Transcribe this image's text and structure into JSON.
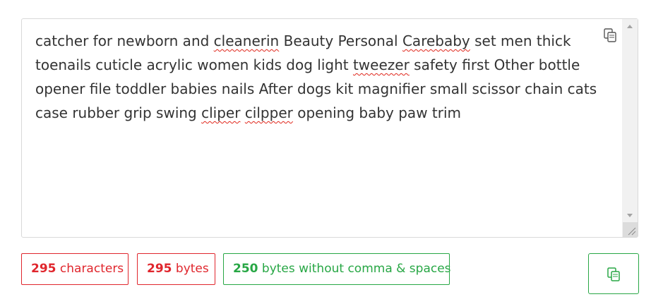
{
  "editor": {
    "segments": [
      {
        "text": "catcher for newborn and ",
        "misspelled": false
      },
      {
        "text": "cleanerin",
        "misspelled": true
      },
      {
        "text": " Beauty Personal ",
        "misspelled": false
      },
      {
        "text": "Carebaby",
        "misspelled": true
      },
      {
        "text": " set men thick toenails cuticle acrylic women kids dog light ",
        "misspelled": false
      },
      {
        "text": "tweezer",
        "misspelled": true
      },
      {
        "text": " safety first Other bottle opener file toddler babies nails After dogs kit magnifier small scissor chain cats case rubber grip swing ",
        "misspelled": false
      },
      {
        "text": "cliper",
        "misspelled": true
      },
      {
        "text": " ",
        "misspelled": false
      },
      {
        "text": "cilpper",
        "misspelled": true
      },
      {
        "text": " opening baby paw trim",
        "misspelled": false
      }
    ],
    "copy_icon": "copy-icon"
  },
  "stats": {
    "characters": {
      "count": "295",
      "label": " characters"
    },
    "bytes": {
      "count": "295",
      "label": " bytes"
    },
    "bytes_no_comma": {
      "count": "250",
      "label": " bytes without comma & spaces"
    }
  },
  "copy_button": {
    "icon": "copy-icon"
  },
  "colors": {
    "red": "#e0262d",
    "green": "#28a745",
    "text": "#333333",
    "border": "#d9d9d9"
  }
}
